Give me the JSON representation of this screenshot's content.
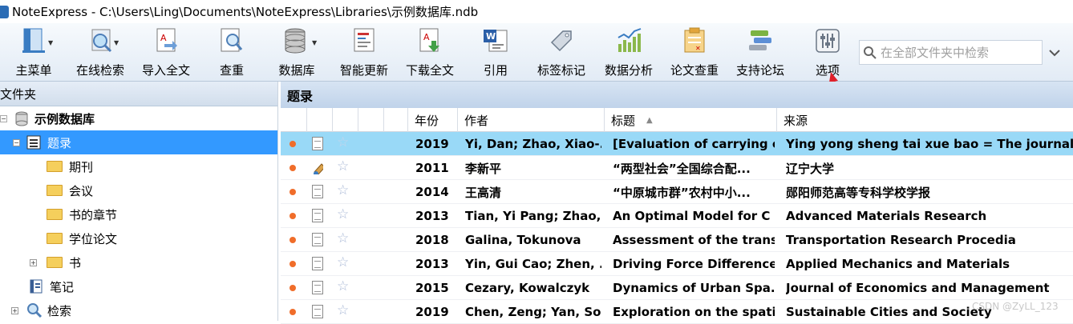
{
  "window": {
    "title": "NoteExpress - C:\\Users\\Ling\\Documents\\NoteExpress\\Libraries\\示例数据库.ndb"
  },
  "toolbar": {
    "buttons": [
      {
        "label": "主菜单",
        "icon": "main-menu-icon"
      },
      {
        "label": "在线检索",
        "icon": "online-search-icon"
      },
      {
        "label": "导入全文",
        "icon": "import-fulltext-icon"
      },
      {
        "label": "查重",
        "icon": "duplicate-check-icon"
      },
      {
        "label": "数据库",
        "icon": "database-icon"
      },
      {
        "label": "智能更新",
        "icon": "smart-update-icon"
      },
      {
        "label": "下载全文",
        "icon": "download-fulltext-icon"
      },
      {
        "label": "引用",
        "icon": "cite-icon"
      },
      {
        "label": "标签标记",
        "icon": "tag-icon"
      },
      {
        "label": "数据分析",
        "icon": "data-analysis-icon"
      },
      {
        "label": "论文查重",
        "icon": "paper-check-icon"
      },
      {
        "label": "支持论坛",
        "icon": "forum-icon"
      },
      {
        "label": "选项",
        "icon": "options-icon"
      }
    ],
    "search_placeholder": "在全部文件夹中检索"
  },
  "left": {
    "header": "文件夹",
    "tree": [
      {
        "label": "示例数据库"
      },
      {
        "label": "题录"
      },
      {
        "label": "期刊"
      },
      {
        "label": "会议"
      },
      {
        "label": "书的章节"
      },
      {
        "label": "学位论文"
      },
      {
        "label": "书"
      },
      {
        "label": "笔记"
      },
      {
        "label": "检索"
      }
    ]
  },
  "right": {
    "header": "题录",
    "columns": [
      "年份",
      "作者",
      "标题",
      "来源"
    ],
    "rows": [
      {
        "year": "2019",
        "author": "Yi, Dan; Zhao, Xiao-...",
        "title": "[Evaluation of carrying c",
        "source": "Ying yong sheng tai xue bao = The journal o",
        "selected": true,
        "icon": "doc"
      },
      {
        "year": "2011",
        "author": "李新平",
        "title": "“两型社会”全国综合配...",
        "source": "辽宁大学",
        "icon": "thesis"
      },
      {
        "year": "2014",
        "author": "王高清",
        "title": "“中原城市群”农村中小...",
        "source": "郧阳师范高等专科学校学报",
        "icon": "doc"
      },
      {
        "year": "2013",
        "author": "Tian, Yi Pang; Zhao,",
        "title": "An Optimal Model for C",
        "source": "Advanced Materials Research",
        "icon": "doc"
      },
      {
        "year": "2018",
        "author": "Galina, Tokunova",
        "title": "Assessment of the trans...",
        "source": "Transportation Research Procedia",
        "icon": "doc"
      },
      {
        "year": "2013",
        "author": "Yin, Gui Cao; Zhen, ...",
        "title": "Driving Force Difference",
        "source": "Applied Mechanics and Materials",
        "icon": "doc"
      },
      {
        "year": "2015",
        "author": "Cezary, Kowalczyk",
        "title": "Dynamics of Urban Spa...",
        "source": "Journal of Economics and Management",
        "icon": "doc"
      },
      {
        "year": "2019",
        "author": "Chen, Zeng; Yan, So...",
        "title": "Exploration on the spati",
        "source": "Sustainable Cities and Society",
        "icon": "doc"
      }
    ]
  },
  "watermark": "CSDN @ZyLL_123",
  "colors": {
    "selection": "#3399ff",
    "row_selection": "#99d9f7",
    "status_dot": "#f06d2a",
    "annotation_arrow": "#e0202a"
  }
}
